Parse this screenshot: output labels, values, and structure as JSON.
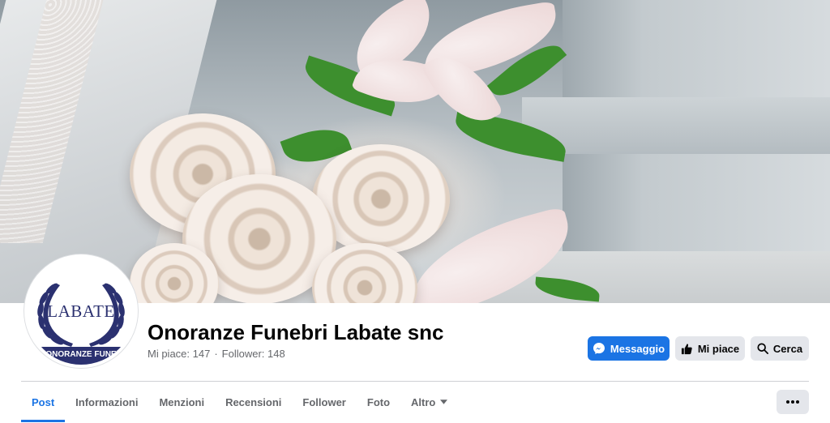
{
  "page": {
    "name": "Onoranze Funebri Labate snc",
    "stats": {
      "likes": "Mi piace: 147",
      "separator": "·",
      "followers": "Follower: 148"
    }
  },
  "logo": {
    "text": "LABATE",
    "band_text": "ONORANZE FUNE"
  },
  "actions": {
    "message_label": "Messaggio",
    "like_label": "Mi piace",
    "search_label": "Cerca"
  },
  "tabs": [
    {
      "label": "Post",
      "active": true
    },
    {
      "label": "Informazioni"
    },
    {
      "label": "Menzioni"
    },
    {
      "label": "Recensioni"
    },
    {
      "label": "Follower"
    },
    {
      "label": "Foto"
    },
    {
      "label": "Altro"
    }
  ],
  "icons": {
    "message": "messenger-icon",
    "like": "thumbs-up-icon",
    "search": "search-icon",
    "more": "more-horizontal-icon",
    "dropdown": "caret-down-icon"
  },
  "colors": {
    "accent": "#1b74e4",
    "secondary_button": "#e4e6eb",
    "muted_text": "#65676b",
    "logo_navy": "#2b3170"
  }
}
